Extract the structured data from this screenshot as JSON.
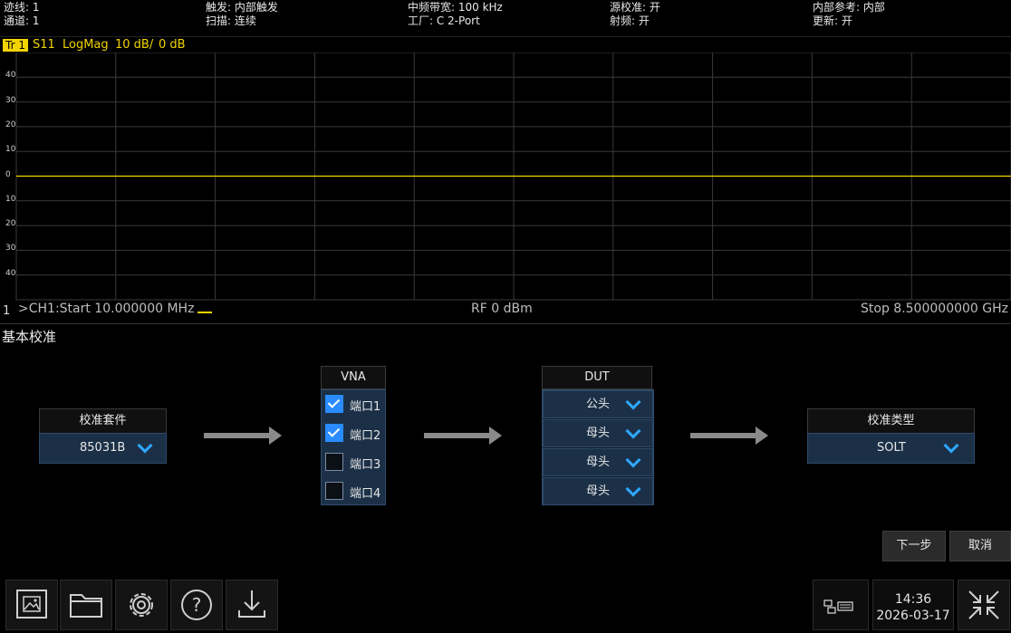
{
  "status": {
    "trace": "迹线: 1",
    "channel": "通道: 1",
    "trigger": "触发: 内部触发",
    "sweep": "扫描: 连续",
    "if_bandwidth": "中频带宽: 100 kHz",
    "cal": "工厂: C 2-Port",
    "source_cal": "源校准: 开",
    "rf": "射频: 开",
    "internal_ref": "内部参考: 内部",
    "update": "更新: 开"
  },
  "trace_header": {
    "badge": "Tr 1",
    "parameter": "S11",
    "format": "LogMag",
    "scale": "10 dB/",
    "ref": "0 dB"
  },
  "chart_data": {
    "type": "line",
    "yticks": [
      "40",
      "30",
      "20",
      "10",
      "0",
      "10",
      "20",
      "30",
      "40"
    ],
    "ylim": [
      -50,
      50
    ],
    "x_start": "Start 10.000000 MHz",
    "x_stop": "Stop 8.500000000 GHz",
    "series": [
      {
        "values": [
          0,
          0,
          0,
          0,
          0,
          0,
          0,
          0,
          0,
          0
        ]
      }
    ]
  },
  "footer": {
    "start": ">CH1:Start 10.000000 MHz",
    "power": "RF 0 dBm",
    "stop": "Stop 8.500000000 GHz",
    "channel_num": "1"
  },
  "calibration": {
    "title": "基本校准",
    "kit_label": "校准套件",
    "kit_value": "85031B",
    "vna_label": "VNA",
    "ports": [
      {
        "label": "端口1",
        "checked": true
      },
      {
        "label": "端口2",
        "checked": true
      },
      {
        "label": "端口3",
        "checked": false
      },
      {
        "label": "端口4",
        "checked": false
      }
    ],
    "dut_label": "DUT",
    "dut_values": [
      "公头",
      "母头",
      "母头",
      "母头"
    ],
    "type_label": "校准类型",
    "type_value": "SOLT",
    "next_label": "下一步",
    "cancel_label": "取消"
  },
  "bottom": {
    "time": "14:36",
    "date": "2026-03-17"
  },
  "colors": {
    "trace": "#f2d400",
    "accent": "#2ea8ff",
    "grid": "#3a3a3a"
  }
}
